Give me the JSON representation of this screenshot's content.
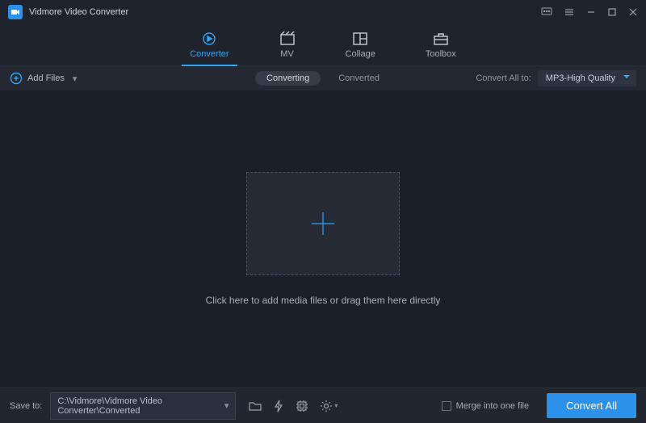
{
  "title": "Vidmore Video Converter",
  "tabs": {
    "converter": "Converter",
    "mv": "MV",
    "collage": "Collage",
    "toolbox": "Toolbox"
  },
  "subbar": {
    "add_files": "Add Files",
    "converting": "Converting",
    "converted": "Converted",
    "convert_all_label": "Convert All to:",
    "convert_all_value": "MP3-High Quality"
  },
  "workspace": {
    "help_text": "Click here to add media files or drag them here directly"
  },
  "bottom": {
    "save_label": "Save to:",
    "save_path": "C:\\Vidmore\\Vidmore Video Converter\\Converted",
    "merge_label": "Merge into one file",
    "convert_button": "Convert All"
  }
}
